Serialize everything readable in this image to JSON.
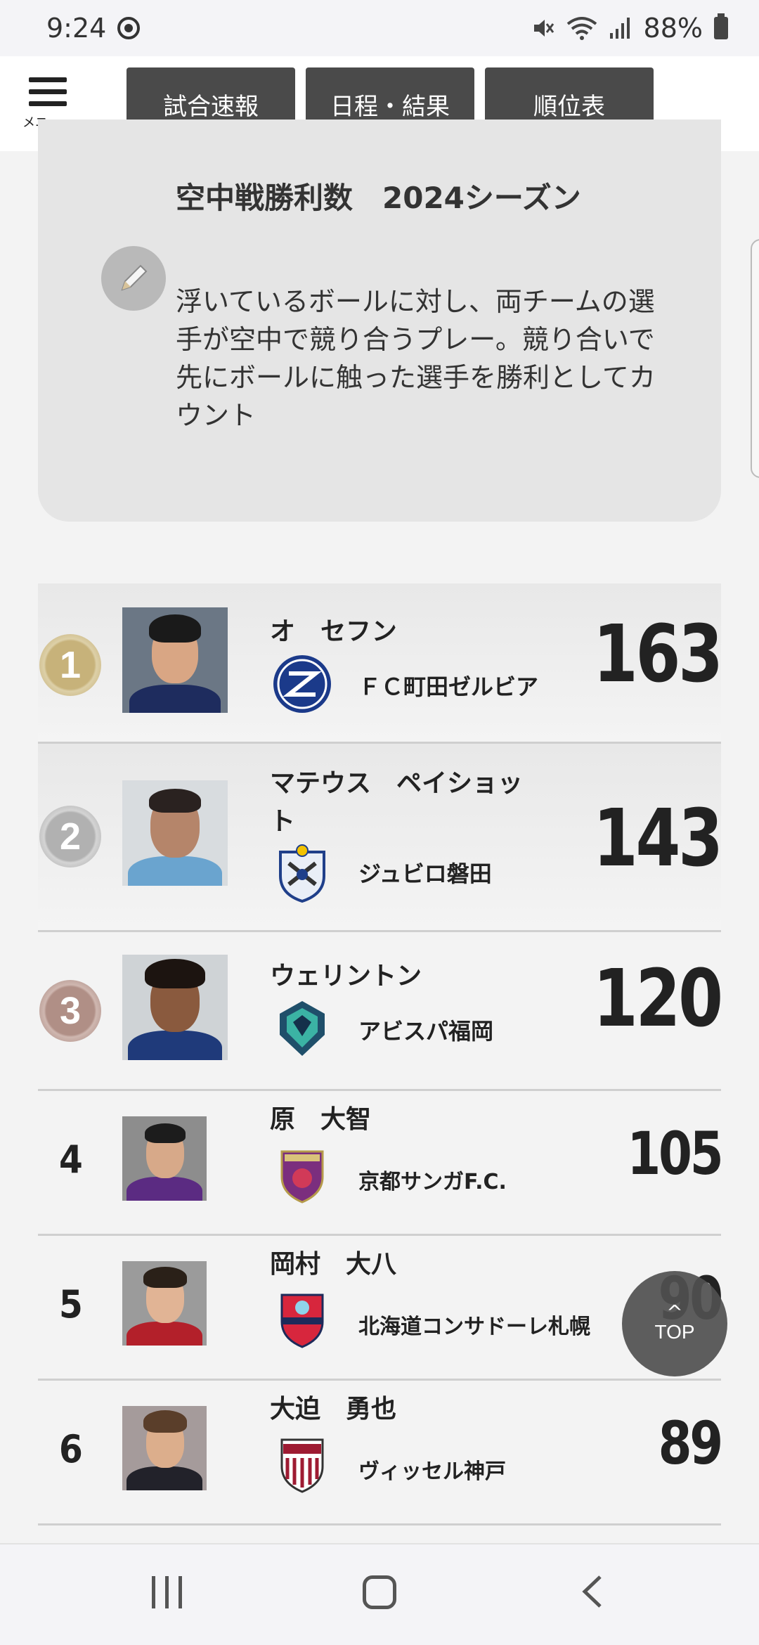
{
  "status_bar": {
    "time": "9:24",
    "battery": "88%",
    "icons": [
      "notification-circle-icon",
      "mute-icon",
      "wifi-icon",
      "signal-icon",
      "battery-icon"
    ]
  },
  "header": {
    "menu_label": "メニュー",
    "tabs": [
      {
        "label": "試合速報"
      },
      {
        "label": "日程・結果"
      },
      {
        "label": "順位表"
      }
    ]
  },
  "info": {
    "title": "空中戦勝利数　2024シーズン",
    "description": "浮いているボールに対し、両チームの選手が空中で競り合うプレー。競り合いで先にボールに触った選手を勝利としてカウント"
  },
  "ranking": [
    {
      "rank": "1",
      "name": "オ　セフン",
      "team": "ＦＣ町田ゼルビア",
      "value": "163"
    },
    {
      "rank": "2",
      "name": "マテウス　ペイショット",
      "team": "ジュビロ磐田",
      "value": "143"
    },
    {
      "rank": "3",
      "name": "ウェリントン",
      "team": "アビスパ福岡",
      "value": "120"
    },
    {
      "rank": "4",
      "name": "原　大智",
      "team": "京都サンガF.C.",
      "value": "105"
    },
    {
      "rank": "5",
      "name": "岡村　大八",
      "team": "北海道コンサドーレ札幌",
      "value": "90"
    },
    {
      "rank": "6",
      "name": "大迫　勇也",
      "team": "ヴィッセル神戸",
      "value": "89"
    }
  ],
  "top_button": {
    "label": "TOP"
  },
  "colors": {
    "nav_tab_bg": "#4a4a4a",
    "card_bg": "#e5e5e5",
    "gold": "#c7b27a",
    "silver": "#b1b1b1",
    "bronze": "#b08f86"
  }
}
